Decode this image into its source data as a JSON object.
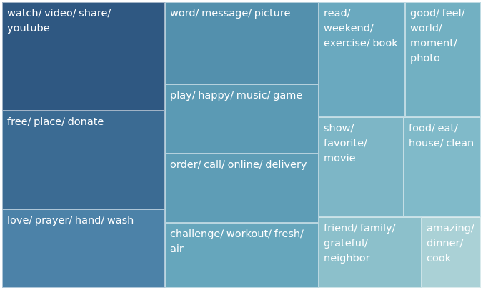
{
  "chart_data": {
    "type": "treemap",
    "items": [
      {
        "label": "watch/ video/ share/ youtube",
        "lines": [
          "watch/ video/ share/",
          "youtube"
        ],
        "value": 34.0,
        "color": "#2f5882"
      },
      {
        "label": "free/ place/ donate",
        "lines": [
          "free/ place/ donate"
        ],
        "value": 31.7,
        "color": "#3b6b93"
      },
      {
        "label": "love/ prayer/ hand/ wash",
        "lines": [
          "love/ prayer/ hand/ wash"
        ],
        "value": 25.7,
        "color": "#4c82a8"
      },
      {
        "label": "word/ message/ picture",
        "lines": [
          "word/ message/ picture"
        ],
        "value": 24.4,
        "color": "#5390ad"
      },
      {
        "label": "play/ happy/ music/ game",
        "lines": [
          "play/ happy/ music/ game"
        ],
        "value": 21.3,
        "color": "#5b9ab4"
      },
      {
        "label": "order/ call/ online/ delivery",
        "lines": [
          "order/ call/ online/ delivery"
        ],
        "value": 21.3,
        "color": "#5e9db6"
      },
      {
        "label": "challenge/ workout/ fresh/ air",
        "lines": [
          "challenge/ workout/ fresh/",
          "air"
        ],
        "value": 20.1,
        "color": "#66a6bc"
      },
      {
        "label": "read/ weekend/ exercise/ book",
        "lines": [
          "read/",
          "weekend/",
          "exercise/ book"
        ],
        "value": 14.8,
        "color": "#6aa9bf"
      },
      {
        "label": "good/ feel/ world/ moment/ photo",
        "lines": [
          "good/ feel/",
          "world/",
          "moment/",
          "photo"
        ],
        "value": 12.5,
        "color": "#72b0c2"
      },
      {
        "label": "show/ favorite/ movie",
        "lines": [
          "show/",
          "favorite/",
          "movie"
        ],
        "value": 12.9,
        "color": "#7db6c6"
      },
      {
        "label": "food/ eat/ house/ clean",
        "lines": [
          "food/ eat/",
          "house/ clean"
        ],
        "value": 11.2,
        "color": "#80bac9"
      },
      {
        "label": "friend/ family/ grateful/ neighbor",
        "lines": [
          "friend/ family/",
          "grateful/",
          "neighbor"
        ],
        "value": 10.8,
        "color": "#8cc0cb"
      },
      {
        "label": "amazing/ dinner/ cook",
        "lines": [
          "amazing/",
          "dinner/",
          "cook"
        ],
        "value": 6.6,
        "color": "#aad1d6"
      }
    ]
  }
}
